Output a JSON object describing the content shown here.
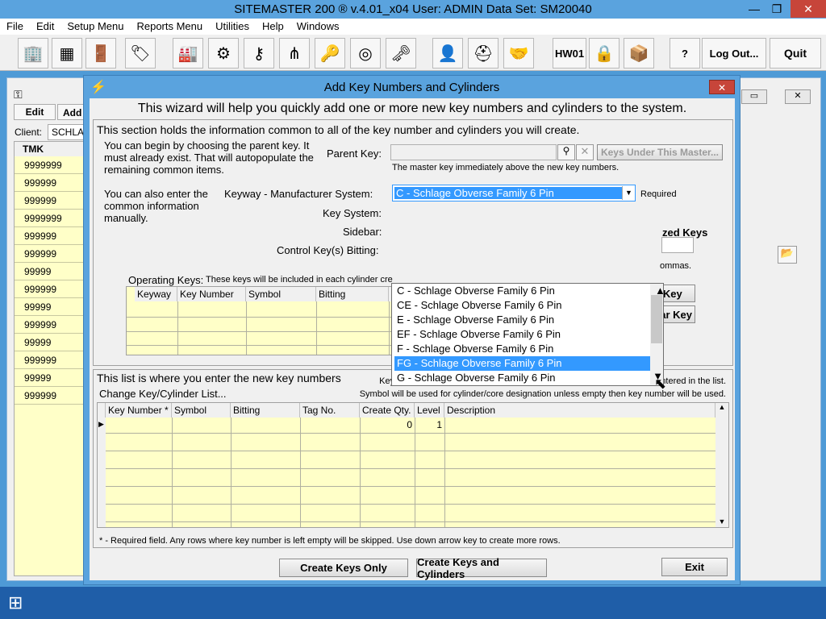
{
  "app": {
    "title": "SITEMASTER 200 ® v.4.01_x04   User: ADMIN   Data Set: SM20040"
  },
  "menu": [
    "File",
    "Edit",
    "Setup Menu",
    "Reports Menu",
    "Utilities",
    "Help",
    "Windows"
  ],
  "toolbar": {
    "hw01": "HW01",
    "logout": "Log Out...",
    "quit": "Quit",
    "help": "?"
  },
  "bg": {
    "edit": "Edit",
    "add": "Add",
    "client_label": "Client:",
    "client_value": "SCHLA",
    "tmk_header": "TMK",
    "tmk_rows": [
      "9999999",
      "999999",
      "999999",
      "9999999",
      "999999",
      "999999",
      "99999",
      "999999",
      "99999",
      "999999",
      "99999",
      "999999",
      "99999",
      "999999"
    ]
  },
  "dialog": {
    "title": "Add Key Numbers and Cylinders",
    "subtitle": "This wizard will help you quickly add one or more new key numbers and cylinders to the system.",
    "section1_title": "This section holds the information common to all of the key number and cylinders you will create.",
    "parent_help": "You can begin by choosing the parent key.  It must already exist.  That will autopopulate the remaining common items.",
    "parent_label": "Parent Key:",
    "keys_under_btn": "Keys Under This Master...",
    "master_note": "The master key immediately above the new key numbers.",
    "manual_help": "You can also enter the common information manually.",
    "keyway_label": "Keyway - Manufacturer System:",
    "keyway_value": "C - Schlage Obverse Family 6 Pin",
    "required": "Required",
    "keysystem_label": "Key System:",
    "sidebar_label": "Sidebar:",
    "control_label": "Control Key(s) Bitting:",
    "authorized_keys": "zed Keys",
    "commas": "ommas.",
    "operating_label": "Operating Keys:",
    "operating_note": "These keys will be included in each cylinder cre",
    "op_headers": [
      "Keyway",
      "Key Number",
      "Symbol",
      "Bitting"
    ],
    "add_key_btn": "d Key",
    "clear_key_btn": "Clear Key",
    "dropdown": [
      "C - Schlage Obverse Family 6 Pin",
      "CE - Schlage Obverse Family 6 Pin",
      "E - Schlage Obverse Family 6 Pin",
      "EF - Schlage Obverse Family 6 Pin",
      "F - Schlage Obverse Family 6 Pin",
      "FG - Schlage Obverse Family 6 Pin",
      "G - Schlage Obverse Family 6 Pin"
    ],
    "dropdown_selected": 5,
    "section2_title": "This list is where you enter the new key numbers",
    "section2_note1": "Key Number and cylinder records will be created for each key number entered in the list.",
    "section2_note2": "Symbol will be used for cylinder/core designation unless empty then key number will be used.",
    "change_list": "Change Key/Cylinder List...",
    "list_headers": [
      "Key Number *",
      "Symbol",
      "Bitting",
      "Tag No.",
      "Create Qty.",
      "Level",
      "Description"
    ],
    "row1_qty": "0",
    "row1_level": "1",
    "footnote": "* - Required field.  Any rows where key number is left empty will be skipped.  Use down arrow key to create more rows.",
    "btn_create_only": "Create Keys Only",
    "btn_create_cyl": "Create Keys and Cylinders",
    "btn_exit": "Exit"
  }
}
